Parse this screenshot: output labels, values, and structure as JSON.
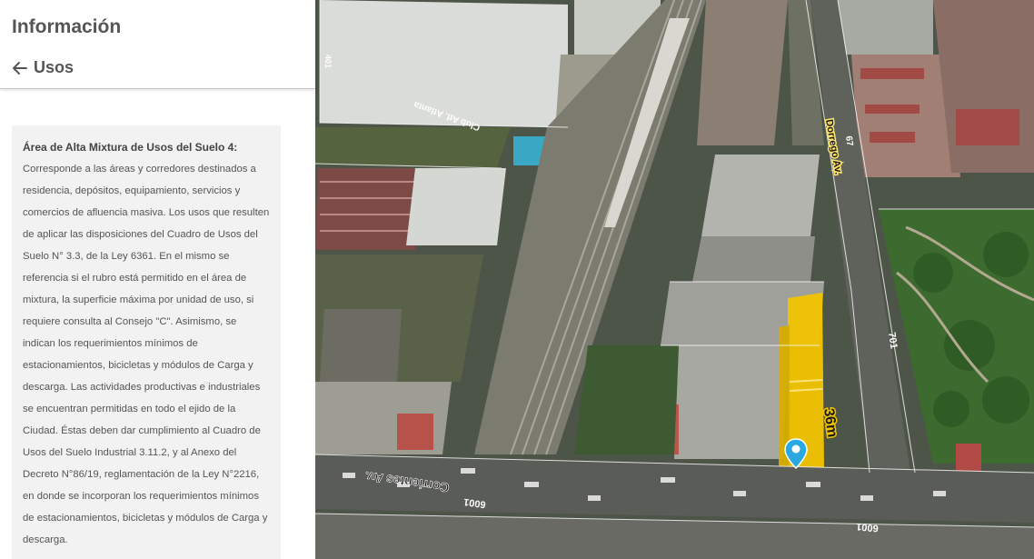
{
  "panel": {
    "title": "Información",
    "back": {
      "label": "Usos",
      "icon": "arrow-left-icon"
    },
    "info": {
      "heading": "Área de Alta Mixtura de Usos del Suelo 4:",
      "body": "Corresponde a las áreas y corredores destinados a residencia, depósitos, equipamiento, servicios y comercios de afluencia masiva. Los usos que resulten de aplicar las disposiciones del Cuadro de Usos del Suelo N° 3.3, de la Ley 6361. En el mismo se referencia si el rubro está permitido en el área de mixtura, la superficie máxima por unidad de uso, si requiere consulta al Consejo \"C\". Asimismo, se indican los requerimientos mínimos de estacionamientos, bicicletas y módulos de Carga y descarga. Las actividades productivas e industriales se encuentran permitidas en todo el ejido de la Ciudad. Éstas deben dar cumplimiento al Cuadro de Usos del Suelo Industrial 3.11.2, y al Anexo del Decreto N°86/19, reglamentación de la Ley N°2216, en donde se incorporan los requerimientos mínimos de estacionamientos, bicicletas y módulos de Carga y descarga."
    }
  },
  "map": {
    "labels": {
      "street_corrientes": "Corrientes Av.",
      "street_dorrego": "Dorrego Av.",
      "club": "Club Atl. Atlanta",
      "height": "36m",
      "num_6001_a": "6001",
      "num_6001_b": "6001",
      "num_701": "701",
      "num_67": "67",
      "num_401": "401"
    },
    "colors": {
      "building_highlight": "#f2c400",
      "marker": "#2aa8e0"
    },
    "marker_icon": "map-pin-icon"
  }
}
